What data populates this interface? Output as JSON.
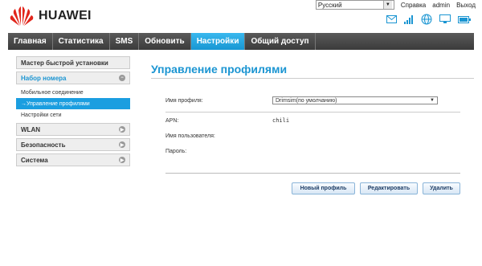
{
  "brand": {
    "name": "HUAWEI",
    "accent": "#1b95d2",
    "logo_color": "#e1251b"
  },
  "topbar": {
    "language": "Русский",
    "help": "Справка",
    "user": "admin",
    "logout": "Выход"
  },
  "status_icons": [
    "mail-icon",
    "signal-icon",
    "globe-icon",
    "monitor-icon",
    "battery-icon"
  ],
  "nav": {
    "items": [
      "Главная",
      "Статистика",
      "SMS",
      "Обновить",
      "Настройки",
      "Общий доступ"
    ],
    "active": "Настройки"
  },
  "sidebar": {
    "wizard": "Мастер быстрой установки",
    "dialup": "Набор номера",
    "dialup_items": [
      "Мобильное соединение",
      "→Управление профилями",
      "Настройки сети"
    ],
    "wlan": "WLAN",
    "security": "Безопасность",
    "system": "Система"
  },
  "main": {
    "title": "Управление профилями",
    "profile_label": "Имя профиля:",
    "profile_value": "Drimsim(по умолчанию)",
    "apn_label": "APN:",
    "apn_value": "chili",
    "user_label": "Имя пользователя:",
    "password_label": "Пароль:",
    "buttons": {
      "new": "Новый профиль",
      "edit": "Редактировать",
      "delete": "Удалить"
    }
  }
}
